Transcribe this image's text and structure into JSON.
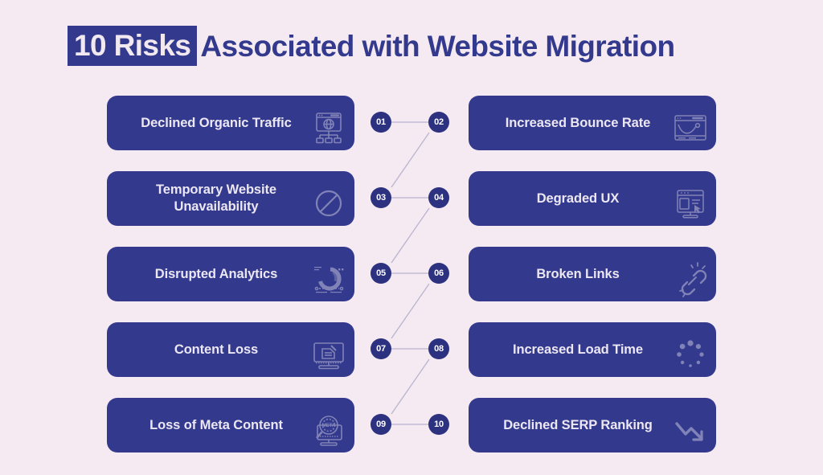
{
  "header": {
    "highlight": "10 Risks",
    "rest": "Associated with Website Migration"
  },
  "colors": {
    "background": "#f5eaf1",
    "card": "#333a8e",
    "circle": "#2c3180",
    "title": "#333a8e",
    "title_highlight_text": "#f2e9f0",
    "card_text": "#ece7f2",
    "connector": "#b9b4cf"
  },
  "items": [
    {
      "number": "01",
      "label": "Declined Organic Traffic",
      "icon": "sitemap-globe-icon",
      "column": "left"
    },
    {
      "number": "02",
      "label": "Increased Bounce Rate",
      "icon": "bounce-chart-icon",
      "column": "right"
    },
    {
      "number": "03",
      "label": "Temporary Website Unavailability",
      "icon": "no-entry-icon",
      "column": "left"
    },
    {
      "number": "04",
      "label": "Degraded UX",
      "icon": "ux-cursor-icon",
      "column": "right"
    },
    {
      "number": "05",
      "label": "Disrupted Analytics",
      "icon": "donut-chart-icon",
      "column": "left"
    },
    {
      "number": "06",
      "label": "Broken Links",
      "icon": "broken-link-icon",
      "column": "right"
    },
    {
      "number": "07",
      "label": "Content Loss",
      "icon": "monitor-document-icon",
      "column": "left"
    },
    {
      "number": "08",
      "label": "Increased Load Time",
      "icon": "loading-spinner-icon",
      "column": "right"
    },
    {
      "number": "09",
      "label": "Loss of Meta Content",
      "icon": "meta-search-icon",
      "column": "left"
    },
    {
      "number": "10",
      "label": "Declined SERP Ranking",
      "icon": "down-trend-arrow-icon",
      "column": "right"
    }
  ]
}
